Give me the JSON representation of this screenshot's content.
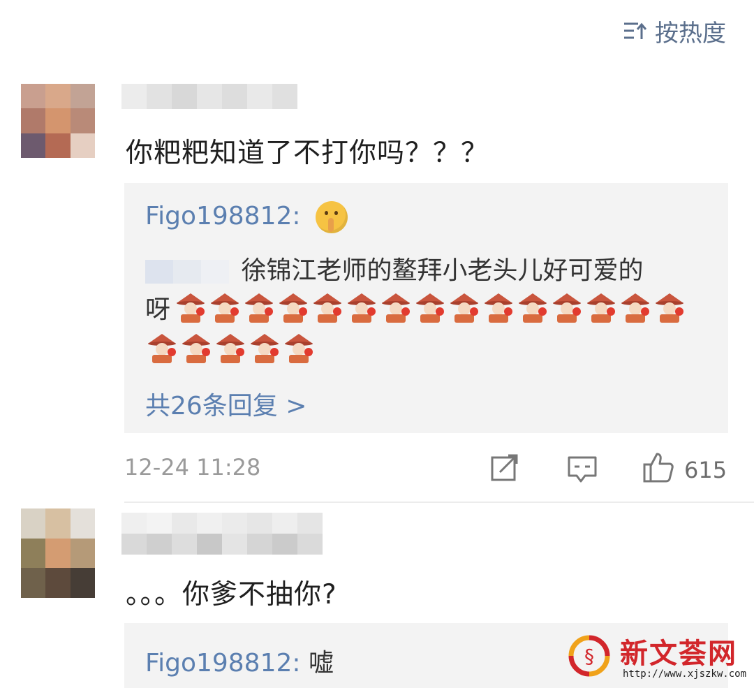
{
  "header": {
    "sort_label": "按热度",
    "sort_icon": "sort-icon"
  },
  "comments": [
    {
      "text": "你粑粑知道了不打你吗？？？",
      "reply_box": {
        "first_reply_user": "Figo198812:",
        "first_reply_emoji": "shushing-face-icon",
        "second_reply_text_line1": "徐锦江老师的鳌拜小老头儿好可爱的",
        "second_reply_text_line2": "呀",
        "sticker_name": "aobai-sticker-icon",
        "sticker_count": 20,
        "more_replies": "共26条回复 >"
      },
      "time": "12-24 11:28",
      "actions": {
        "share_icon": "share-icon",
        "comment_icon": "comment-icon",
        "like_icon": "thumbs-up-icon",
        "like_count": "615"
      }
    },
    {
      "text": "。。。你爹不抽你?",
      "reply_box": {
        "first_reply_user": "Figo198812:",
        "first_reply_text": "嘘"
      }
    }
  ],
  "watermark": {
    "title": "新文荟网",
    "url": "http://www.xjszkw.com"
  },
  "colors": {
    "link": "#5b7fb0",
    "reply_bg": "#f3f3f3",
    "watermark_red": "#d2262b"
  }
}
